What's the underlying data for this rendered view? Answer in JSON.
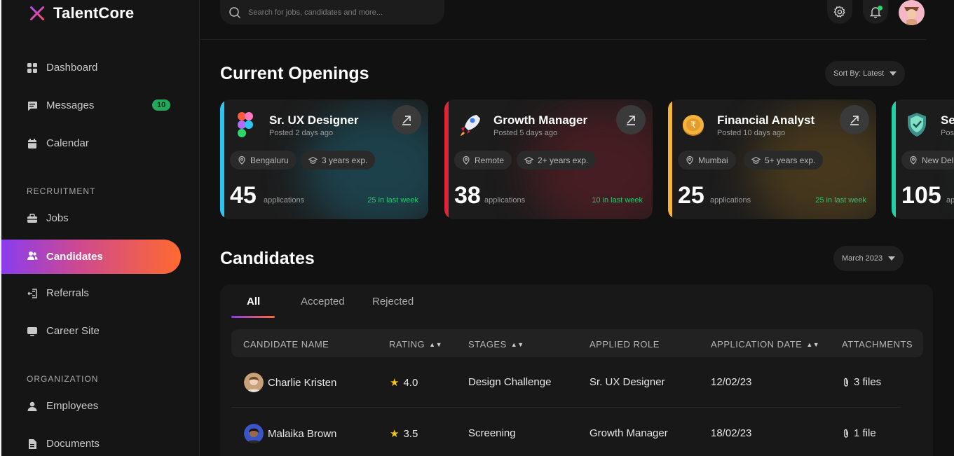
{
  "app": {
    "name": "TalentCore"
  },
  "search": {
    "placeholder": "Search for jobs, candidates and more..."
  },
  "sidebar": {
    "main_items": [
      {
        "label": "Dashboard"
      },
      {
        "label": "Messages",
        "badge": "10"
      },
      {
        "label": "Calendar"
      }
    ],
    "recruitment_label": "RECRUITMENT",
    "recruitment_items": [
      {
        "label": "Jobs"
      },
      {
        "label": "Candidates",
        "active": true
      },
      {
        "label": "Referrals"
      },
      {
        "label": "Career Site"
      }
    ],
    "organization_label": "ORGANIZATION",
    "organization_items": [
      {
        "label": "Employees"
      },
      {
        "label": "Documents"
      }
    ]
  },
  "openings": {
    "title": "Current Openings",
    "sort_label": "Sort By: Latest",
    "jobs": [
      {
        "title": "Sr. UX Designer",
        "posted": "Posted 2 days ago",
        "location": "Bengaluru",
        "experience": "3 years exp.",
        "count": "45",
        "count_label": "applications",
        "last_week": "25 in last week",
        "accent": "#2ec4f1",
        "glow": "#1f6f86"
      },
      {
        "title": "Growth Manager",
        "posted": "Posted 5 days ago",
        "location": "Remote",
        "experience": "2+ years exp.",
        "count": "38",
        "count_label": "applications",
        "last_week": "10 in last week",
        "accent": "#e0253a",
        "glow": "#7a1f2a"
      },
      {
        "title": "Financial Analyst",
        "posted": "Posted 10 days ago",
        "location": "Mumbai",
        "experience": "5+ years exp.",
        "count": "25",
        "count_label": "applications",
        "last_week": "25 in last week",
        "accent": "#f2b43a",
        "glow": "#7a5a1f"
      },
      {
        "title": "Se",
        "posted": "Post",
        "location": "New Del",
        "experience": "",
        "count": "105",
        "count_label": "ap",
        "last_week": "",
        "accent": "#1fd1a5",
        "glow": "#1f6a58"
      }
    ]
  },
  "candidates": {
    "title": "Candidates",
    "period_label": "March 2023",
    "tabs": [
      "All",
      "Accepted",
      "Rejected"
    ],
    "columns": [
      "CANDIDATE NAME",
      "RATING",
      "STAGES",
      "APPLIED ROLE",
      "APPLICATION DATE",
      "ATTACHMENTS"
    ],
    "rows": [
      {
        "name": "Charlie Kristen",
        "rating": "4.0",
        "stage": "Design Challenge",
        "role": "Sr. UX Designer",
        "date": "12/02/23",
        "attachments": "3 files"
      },
      {
        "name": "Malaika Brown",
        "rating": "3.5",
        "stage": "Screening",
        "role": "Growth Manager",
        "date": "18/02/23",
        "attachments": "1 file"
      }
    ]
  },
  "icons": {
    "logo": "sparkle-logo-icon",
    "dashboard": "grid-icon",
    "messages": "chat-icon",
    "calendar": "calendar-icon",
    "jobs": "briefcase-icon",
    "candidates": "users-icon",
    "referrals": "referral-icon",
    "career_site": "monitor-icon",
    "employees": "person-icon",
    "documents": "document-icon",
    "settings": "gear-icon",
    "notifications": "bell-icon"
  }
}
